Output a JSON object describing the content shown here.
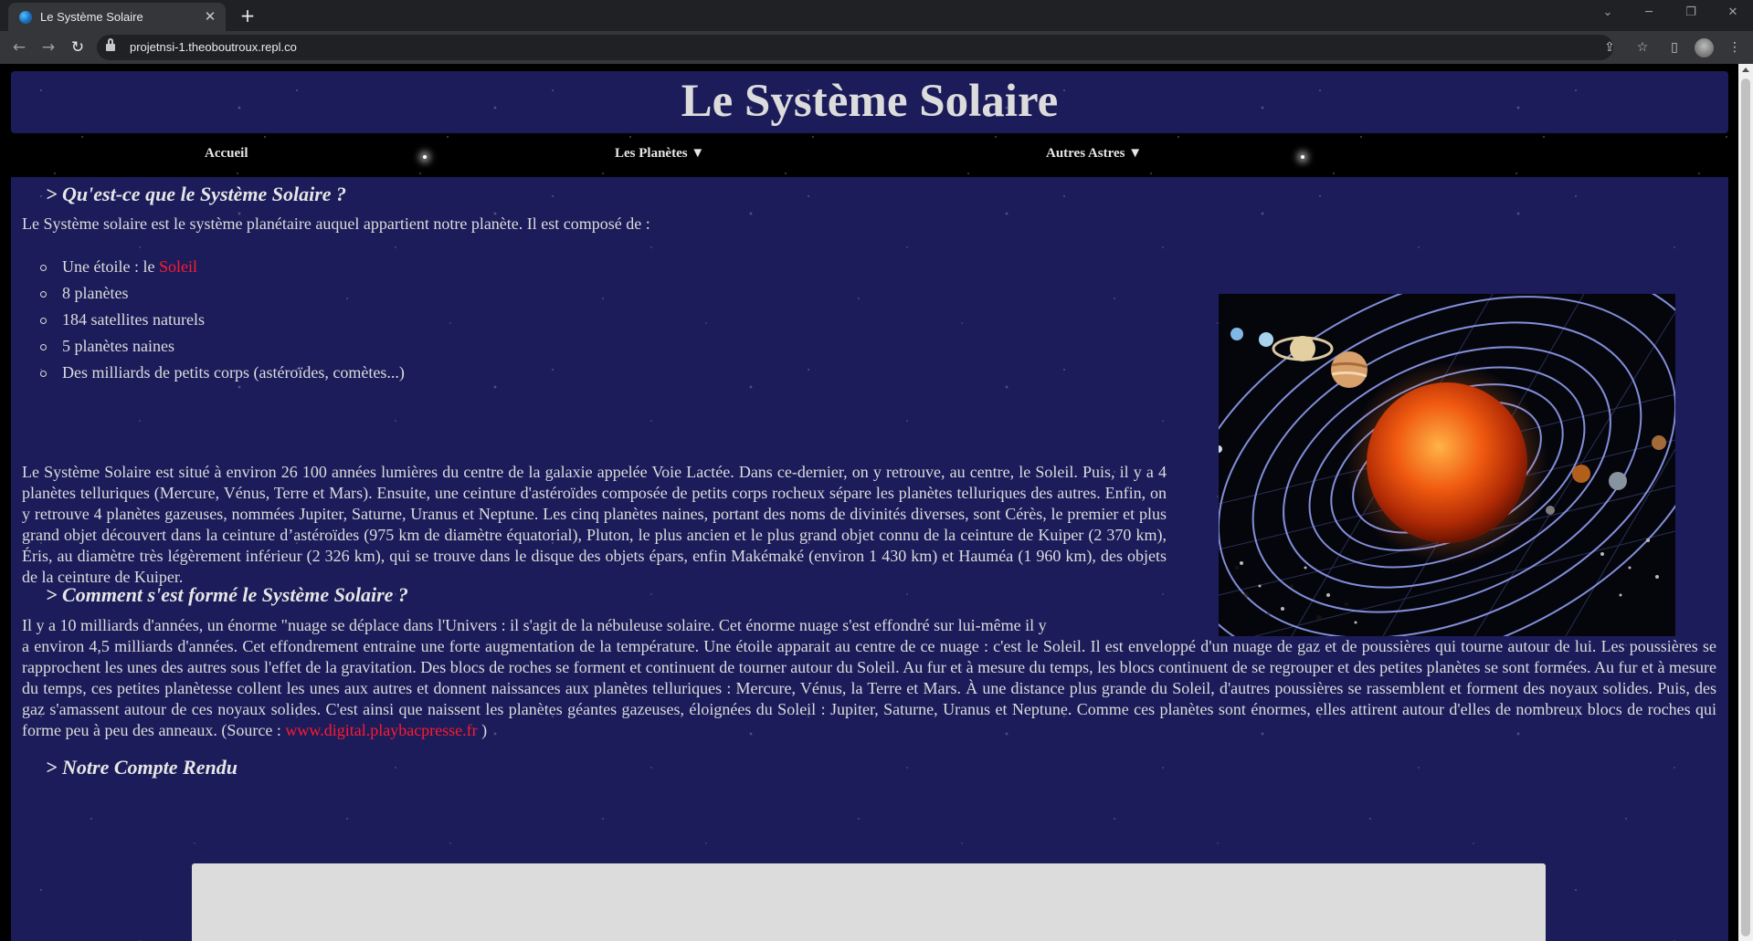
{
  "browser": {
    "tab_title": "Le Système Solaire",
    "tab_close": "✕",
    "new_tab": "+",
    "url": "projetnsi-1.theoboutroux.repl.co"
  },
  "site": {
    "title": "Le Système Solaire",
    "menu": [
      "Accueil",
      "Les Planètes ▼",
      "Autres Astres ▼"
    ]
  },
  "sections": {
    "s1_title": "> Qu'est-ce que le Système Solaire ?",
    "s1_intro": "Le Système solaire est le système planétaire auquel appartient notre planète. Il est composé de :",
    "s1_list": {
      "item0_prefix": "Une étoile : le ",
      "item0_link": "Soleil",
      "item1": "8 planètes",
      "item2": "184 satellites naturels",
      "item3": "5 planètes naines",
      "item4": "Des milliards de petits corps (astéroïdes, comètes...)"
    },
    "s1_paragraph": "Le Système Solaire est situé à environ 26 100 années lumières du centre de la galaxie appelée Voie Lactée. Dans ce-dernier, on y retrouve, au centre, le Soleil. Puis, il y a 4 planètes telluriques (Mercure, Vénus, Terre et Mars). Ensuite, une ceinture d'astéroïdes composée de petits corps rocheux sépare les planètes telluriques des autres. Enfin, on y retrouve 4 planètes gazeuses, nommées Jupiter, Saturne, Uranus et Neptune. Les cinq planètes naines, portant des noms de divinités diverses, sont Cérès, le premier et plus grand objet découvert dans la ceinture d’astéroïdes (975 km de diamètre équatorial), Pluton, le plus ancien et le plus grand objet connu de la ceinture de Kuiper (2 370 km), Éris, au diamètre très légèrement inférieur (2 326 km), qui se trouve dans le disque des objets épars, enfin Makémaké (environ 1 430 km) et Hauméa (1 960 km), des objets de la ceinture de Kuiper.",
    "s2_title": "> Comment s'est formé le Système Solaire ?",
    "s2_line1": "Il y a 10 milliards d'années, un énorme \"nuage se déplace dans l'Univers : il s'agit de la nébuleuse solaire. Cet énorme nuage s'est effondré sur lui-même il y",
    "s2_paragraph": "a environ 4,5 milliards d'années. Cet effondrement entraine une forte augmentation de la température. Une étoile apparait au centre de ce nuage : c'est le Soleil. Il est enveloppé d'un nuage de gaz et de poussières qui tourne autour de lui. Les poussières se rapprochent les unes des autres sous l'effet de la gravitation. Des blocs de roches se forment et continuent de tourner autour du Soleil. Au fur et à mesure du temps, les blocs continuent de se regrouper et des petites planètes se sont formées. Au fur et à mesure du temps, ces petites planètesse collent les unes aux autres et donnent naissances aux planètes telluriques : Mercure, Vénus, la Terre et Mars. À une distance plus grande du Soleil, d'autres poussières se rassemblent et forment des noyaux solides. Puis, des gaz s'amassent autour de ces noyaux solides. C'est ainsi que naissent les planètes géantes gazeuses, éloignées du Soleil : Jupiter, Saturne, Uranus et Neptune. Comme ces planètes sont énormes, elles attirent autour d'elles de nombreux blocs de roches qui forme peu à peu des anneaux. (Source : ",
    "s2_source_link": "www.digital.playbacpresse.fr",
    "s2_source_end": " )",
    "s3_title": "> Notre Compte Rendu"
  },
  "colors": {
    "panel": "#1c1c5a",
    "link": "#ff1a2e",
    "text": "#dcdcdc"
  }
}
